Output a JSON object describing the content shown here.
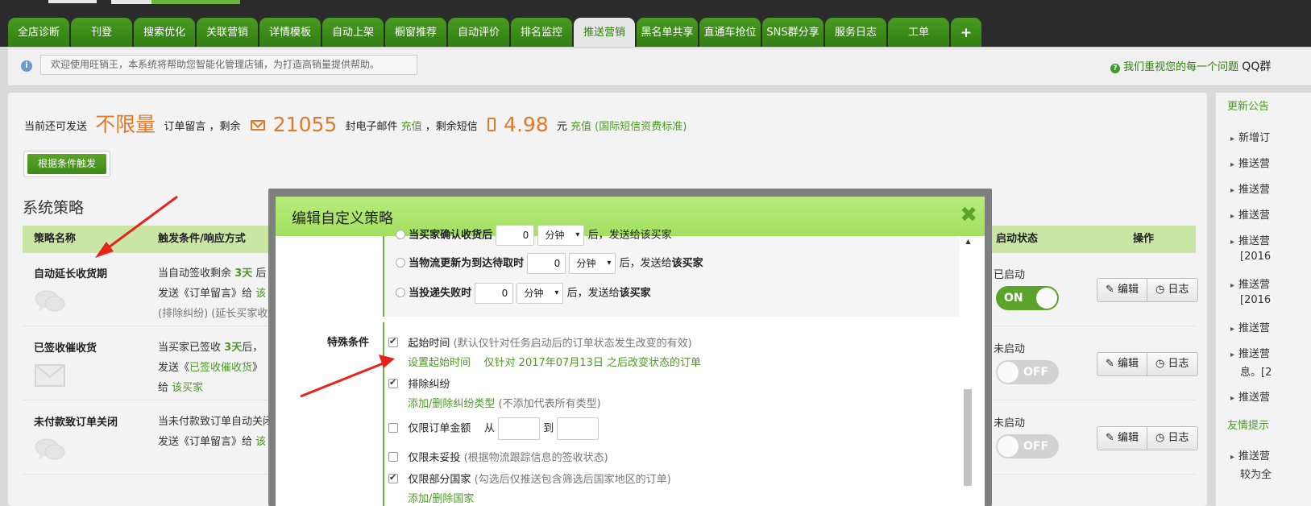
{
  "tabs": [
    {
      "label": "全店诊断",
      "w": 76
    },
    {
      "label": "刊登",
      "w": 76
    },
    {
      "label": "搜索优化",
      "w": 76
    },
    {
      "label": "关联营销",
      "w": 76
    },
    {
      "label": "详情模板",
      "w": 76
    },
    {
      "label": "自动上架",
      "w": 76
    },
    {
      "label": "橱窗推荐",
      "w": 76
    },
    {
      "label": "自动评价",
      "w": 76
    },
    {
      "label": "排名监控",
      "w": 76
    },
    {
      "label": "推送营销",
      "w": 76,
      "active": true
    },
    {
      "label": "黑名单共享",
      "w": 76
    },
    {
      "label": "直通车抢位",
      "w": 76
    },
    {
      "label": "SNS群分享",
      "w": 76
    },
    {
      "label": "服务日志",
      "w": 76
    },
    {
      "label": "工单",
      "w": 76
    },
    {
      "label": "+",
      "w": 38
    }
  ],
  "notice": {
    "text": "欢迎使用旺销王，本系统将帮助您智能化管理店铺，为打造高销量提供帮助。",
    "right_text": "我们重视您的每一个问题",
    "qq": "QQ群"
  },
  "quota": {
    "prefix": "当前还可发送",
    "unlimited": "不限量",
    "msg_label": "订单留言",
    "remain_label": "，剩余",
    "email_count": "21055",
    "email_unit": "封电子邮件",
    "recharge1": "充值",
    "sms_label": "，剩余短信",
    "sms_amount": "4.98",
    "sms_unit": "元",
    "recharge2": "充值 (国际短信资费标准)"
  },
  "trigger_button": "根据条件触发",
  "section_title": "系统策略",
  "table": {
    "headers": {
      "name": "策略名称",
      "trigger": "触发条件/响应方式",
      "status": "启动状态",
      "ops": "操作"
    },
    "rows": [
      {
        "name": "自动延长收货期",
        "line1_a": "当自动签收剩余",
        "line1_b": "3天",
        "line1_c": "后",
        "line2_a": "发送《订单留言》给",
        "line2_b": "该",
        "line3": "(排除纠纷) (延长买家收货",
        "status": "已启动",
        "toggle": "ON"
      },
      {
        "name": "已签收催收货",
        "line1_a": "当买家已签收",
        "line1_b": "3天",
        "line1_c": "后，",
        "line2_a": "发送《",
        "line2_b": "已签收催收货",
        "line2_c": "》",
        "line3_a": "给",
        "line3_b": "该买家",
        "status": "未启动",
        "toggle": "OFF"
      },
      {
        "name": "未付款致订单关闭",
        "line1_a": "当未付款致订单自动关闭",
        "line2_a": "发送《订单留言》给",
        "line2_b": "该",
        "status": "未启动",
        "toggle": "OFF"
      }
    ],
    "edit_label": "编辑",
    "log_label": "日志"
  },
  "side": {
    "title1": "更新公告",
    "items": [
      "新增订",
      "推送营",
      "推送营",
      "推送营",
      "推送营",
      "推送营",
      "推送营",
      "推送营",
      "推送营"
    ],
    "subs": [
      "[2016",
      "[2016",
      "息。[2"
    ],
    "title2": "友情提示",
    "item_last": "推送营",
    "sub_last": "较为全"
  },
  "modal": {
    "title": "编辑自定义策略",
    "close": "✖",
    "partial_top": "当买家确认收货后",
    "partial_num": "0",
    "partial_unit": "分钟",
    "partial_tail": "后，发送给该买家",
    "rows": [
      {
        "label": "当物流更新为到达待取时",
        "num": "0",
        "unit": "分钟",
        "tail_a": "后，发送给",
        "tail_b": "该买家"
      },
      {
        "label": "当投递失败时",
        "num": "0",
        "unit": "分钟",
        "tail_a": "后，发送给",
        "tail_b": "该买家"
      }
    ],
    "special_label": "特殊条件",
    "cond": {
      "start_label": "起始时间",
      "start_note": "(默认仅针对任务启动后的订单状态发生改变的有效)",
      "start_link": "设置起始时间",
      "start_desc": "仅针对 2017年07月13日 之后改变状态的订单",
      "dispute_label": "排除纠纷",
      "dispute_link": "添加/删除纠纷类型",
      "dispute_note": "(不添加代表所有类型)",
      "amount_label": "仅限订单金额",
      "amount_from": "从",
      "amount_to": "到",
      "undelivered_label": "仅限未妥投",
      "undelivered_note": "(根据物流跟踪信息的签收状态)",
      "country_label": "仅限部分国家",
      "country_note": "(勾选后仅推送包含筛选后国家地区的订单)",
      "country_link": "添加/删除国家"
    }
  },
  "colors": {
    "brand_green": "#4a9a22",
    "accent_orange": "#e07a2a",
    "header_green": "#c9e6a5",
    "arrow_red": "#e8231c"
  }
}
